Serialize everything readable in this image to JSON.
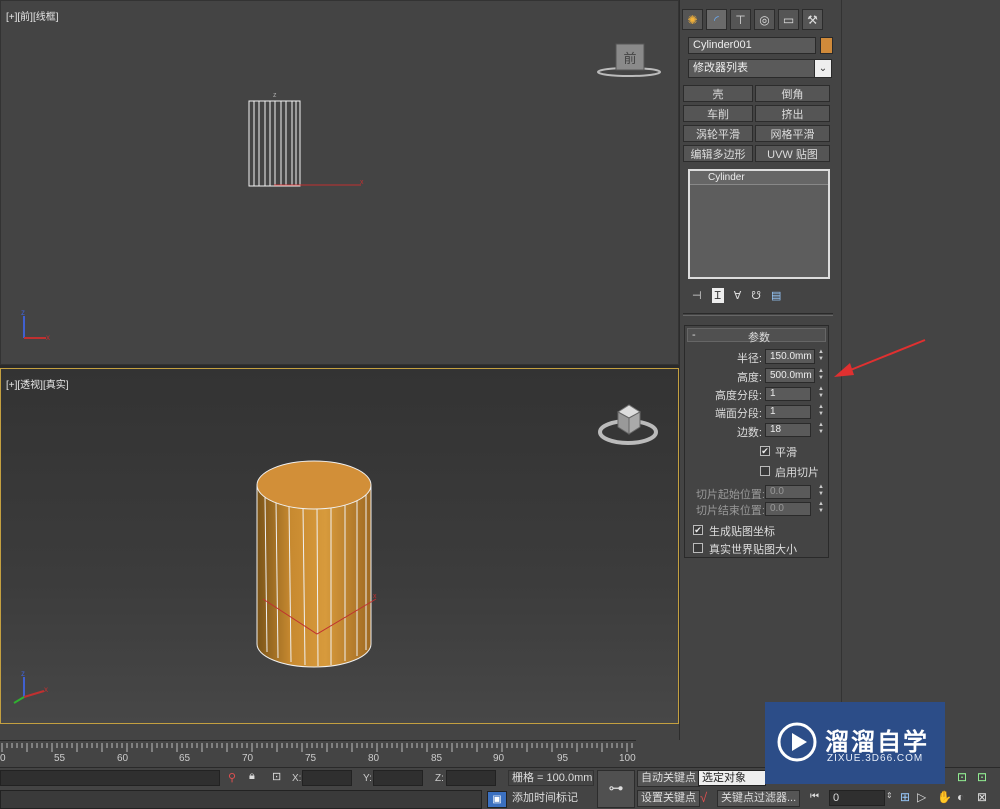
{
  "viewports": {
    "top": {
      "label": "[+][前][线框]",
      "navcube_face": "前"
    },
    "perspective": {
      "label": "[+][透视][真实]"
    }
  },
  "command_panel": {
    "tabs": [
      {
        "icon": "sun-icon"
      },
      {
        "icon": "modify-arc-icon"
      },
      {
        "icon": "hierarchy-icon"
      },
      {
        "icon": "motion-icon"
      },
      {
        "icon": "display-monitor-icon"
      },
      {
        "icon": "utilities-hammer-icon"
      }
    ],
    "object_name": "Cylinder001",
    "object_color": "#d08a3a",
    "modifier_list": "修改器列表",
    "modifier_buttons": [
      "壳",
      "倒角",
      "车削",
      "挤出",
      "涡轮平滑",
      "网格平滑",
      "编辑多边形",
      "UVW 贴图"
    ],
    "stack_items": [
      "Cylinder"
    ],
    "params": {
      "rollout_title": "参数",
      "rollout_toggle": "-",
      "radius_label": "半径:",
      "radius_value": "150.0mm",
      "height_label": "高度:",
      "height_value": "500.0mm",
      "height_segments_label": "高度分段:",
      "height_segments_value": "1",
      "cap_segments_label": "端面分段:",
      "cap_segments_value": "1",
      "sides_label": "边数:",
      "sides_value": "18",
      "smooth_label": "平滑",
      "smooth_checked": "✔",
      "slice_on_label": "启用切片",
      "slice_from_label": "切片起始位置:",
      "slice_from_value": "0.0",
      "slice_to_label": "切片结束位置:",
      "slice_to_value": "0.0",
      "gen_map_label": "生成贴图坐标",
      "gen_map_checked": "✔",
      "real_world_label": "真实世界贴图大小"
    }
  },
  "timeline": {
    "ticks": [
      "0",
      "55",
      "60",
      "65",
      "70",
      "75",
      "80",
      "85",
      "90",
      "95",
      "100"
    ]
  },
  "status_bar": {
    "x_label": "X:",
    "y_label": "Y:",
    "z_label": "Z:",
    "grid": "栅格 = 100.0mm",
    "auto_key": "自动关键点",
    "set_key": "设置关键点",
    "selection_set": "选定对象",
    "key_filters": "关键点过滤器...",
    "add_time_tag": "添加时间标记",
    "frame_value": "0"
  },
  "watermark": {
    "title": "溜溜自学",
    "url": "ZIXUE.3D66.COM"
  }
}
